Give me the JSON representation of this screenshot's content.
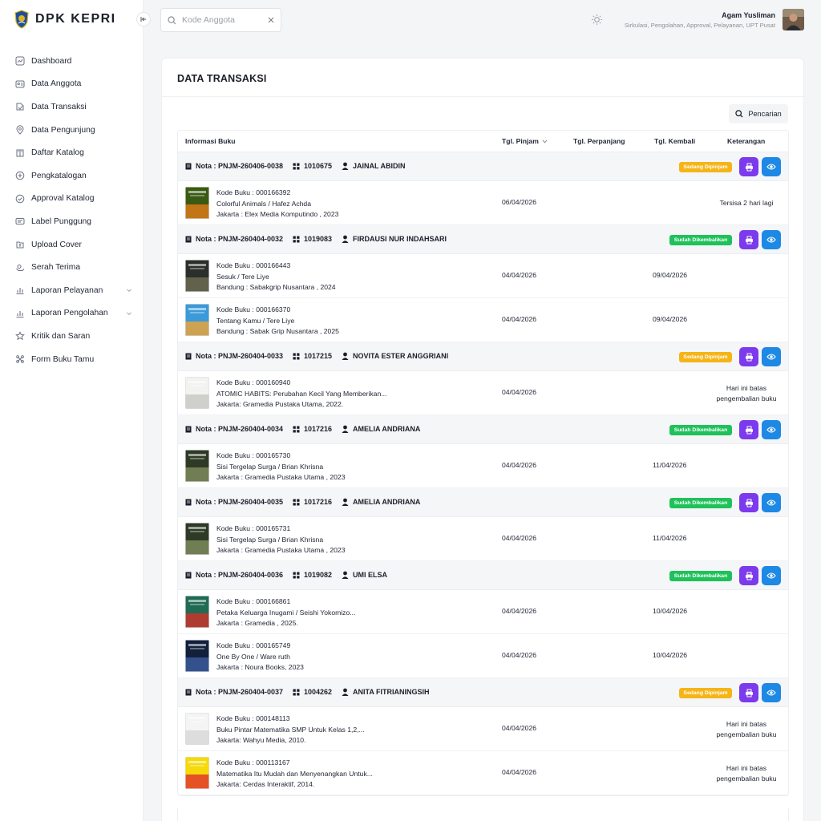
{
  "app": {
    "logo_text": "DPK KEPRI"
  },
  "search": {
    "placeholder": "Kode Anggota"
  },
  "user": {
    "name": "Agam Yusliman",
    "roles": "Sirkulasi, Pengolahan, Approval, Pelayanan, UPT Pusat"
  },
  "sidebar": {
    "items": [
      {
        "label": "Dashboard",
        "icon": "dashboard-icon"
      },
      {
        "label": "Data Anggota",
        "icon": "id-card-icon"
      },
      {
        "label": "Data Transaksi",
        "icon": "transaction-icon"
      },
      {
        "label": "Data Pengunjung",
        "icon": "location-pin-icon"
      },
      {
        "label": "Daftar Katalog",
        "icon": "catalog-icon"
      },
      {
        "label": "Pengkatalogan",
        "icon": "plus-circle-icon"
      },
      {
        "label": "Approval Katalog",
        "icon": "check-circle-icon"
      },
      {
        "label": "Label Punggung",
        "icon": "label-icon"
      },
      {
        "label": "Upload Cover",
        "icon": "upload-icon"
      },
      {
        "label": "Serah Terima",
        "icon": "handover-icon"
      },
      {
        "label": "Laporan Pelayanan",
        "icon": "chart-icon"
      },
      {
        "label": "Laporan Pengolahan",
        "icon": "chart-icon"
      },
      {
        "label": "Kritik dan Saran",
        "icon": "star-icon"
      },
      {
        "label": "Form Buku Tamu",
        "icon": "form-icon"
      }
    ]
  },
  "page": {
    "title": "DATA TRANSAKSI",
    "search_button": "Pencarian"
  },
  "table": {
    "headers": {
      "info": "Informasi Buku",
      "tgl_pinjam": "Tgl. Pinjam",
      "tgl_perpanjang": "Tgl. Perpanjang",
      "tgl_kembali": "Tgl. Kembali",
      "keterangan": "Keterangan"
    },
    "transactions": [
      {
        "nota": "Nota : PNJM-260406-0038",
        "member_id": "1010675",
        "member_name": "JAINAL ABIDIN",
        "status": "Sedang Dipinjam",
        "status_color": "#f5b417",
        "books": [
          {
            "kode": "Kode Buku : 000166392",
            "title": "Colorful Animals / Hafez Achda",
            "publisher": "Jakarta : Elex Media Komputindo , 2023",
            "tgl_pinjam": "06/04/2026",
            "tgl_kembali": "",
            "keterangan": [
              "Tersisa 2 hari lagi"
            ],
            "cover": [
              "#3a5a14",
              "#d97a16"
            ]
          }
        ]
      },
      {
        "nota": "Nota : PNJM-260404-0032",
        "member_id": "1019083",
        "member_name": "FIRDAUSI NUR INDAHSARI",
        "status": "Sudah Dikembalikan",
        "status_color": "#1fc15a",
        "books": [
          {
            "kode": "Kode Buku : 000166443",
            "title": "Sesuk / Tere Liye",
            "publisher": "Bandung : Sabakgrip Nusantara , 2024",
            "tgl_pinjam": "04/04/2026",
            "tgl_kembali": "09/04/2026",
            "keterangan": [],
            "cover": [
              "#2b2e2a",
              "#6b6a52"
            ]
          },
          {
            "kode": "Kode Buku : 000166370",
            "title": "Tentang Kamu / Tere Liye",
            "publisher": "Bandung : Sabak Grip Nusantara , 2025",
            "tgl_pinjam": "04/04/2026",
            "tgl_kembali": "09/04/2026",
            "keterangan": [],
            "cover": [
              "#3b9ad9",
              "#e8a33a"
            ]
          }
        ]
      },
      {
        "nota": "Nota : PNJM-260404-0033",
        "member_id": "1017215",
        "member_name": "NOVITA ESTER ANGGRIANI",
        "status": "Sedang Dipinjam",
        "status_color": "#f5b417",
        "books": [
          {
            "kode": "Kode Buku : 000160940",
            "title": "ATOMIC HABITS: Perubahan Kecil Yang Memberikan...",
            "publisher": "Jakarta: Gramedia Pustaka Utama, 2022.",
            "tgl_pinjam": "04/04/2026",
            "tgl_kembali": "",
            "keterangan": [
              "Hari ini batas",
              "pengembalian buku"
            ],
            "cover": [
              "#f2f2f0",
              "#c9c9c4"
            ]
          }
        ]
      },
      {
        "nota": "Nota : PNJM-260404-0034",
        "member_id": "1017216",
        "member_name": "AMELIA ANDRIANA",
        "status": "Sudah Dikembalikan",
        "status_color": "#1fc15a",
        "books": [
          {
            "kode": "Kode Buku : 000165730",
            "title": "Sisi Tergelap Surga / Brian Khrisna",
            "publisher": "Jakarta : Gramedia Pustaka Utama , 2023",
            "tgl_pinjam": "04/04/2026",
            "tgl_kembali": "11/04/2026",
            "keterangan": [],
            "cover": [
              "#2f3a26",
              "#7c8a5a"
            ]
          }
        ]
      },
      {
        "nota": "Nota : PNJM-260404-0035",
        "member_id": "1017216",
        "member_name": "AMELIA ANDRIANA",
        "status": "Sudah Dikembalikan",
        "status_color": "#1fc15a",
        "books": [
          {
            "kode": "Kode Buku : 000165731",
            "title": "Sisi Tergelap Surga / Brian Khrisna",
            "publisher": "Jakarta : Gramedia Pustaka Utama , 2023",
            "tgl_pinjam": "04/04/2026",
            "tgl_kembali": "11/04/2026",
            "keterangan": [],
            "cover": [
              "#2f3a26",
              "#7c8a5a"
            ]
          }
        ]
      },
      {
        "nota": "Nota : PNJM-260404-0036",
        "member_id": "1019082",
        "member_name": "UMI ELSA",
        "status": "Sudah Dikembalikan",
        "status_color": "#1fc15a",
        "books": [
          {
            "kode": "Kode Buku : 000166861",
            "title": "Petaka Keluarga Inugami / Seishi Yokomizo...",
            "publisher": "Jakarta : Gramedia , 2025.",
            "tgl_pinjam": "04/04/2026",
            "tgl_kembali": "10/04/2026",
            "keterangan": [],
            "cover": [
              "#1f6b54",
              "#c8342c"
            ]
          },
          {
            "kode": "Kode Buku : 000165749",
            "title": "One By One / Ware ruth",
            "publisher": "Jakarta : Noura Books, 2023",
            "tgl_pinjam": "04/04/2026",
            "tgl_kembali": "10/04/2026",
            "keterangan": [],
            "cover": [
              "#13203c",
              "#3a5b9a"
            ]
          }
        ]
      },
      {
        "nota": "Nota : PNJM-260404-0037",
        "member_id": "1004262",
        "member_name": "ANITA FITRIANINGSIH",
        "status": "Sedang Dipinjam",
        "status_color": "#f5b417",
        "books": [
          {
            "kode": "Kode Buku : 000148113",
            "title": "Buku Pintar Matematika SMP Untuk Kelas 1,2,...",
            "publisher": "Jakarta: Wahyu Media, 2010.",
            "tgl_pinjam": "04/04/2026",
            "tgl_kembali": "",
            "keterangan": [
              "Hari ini batas",
              "pengembalian buku"
            ],
            "cover": [
              "#f4f4f4",
              "#d8d8d8"
            ]
          },
          {
            "kode": "Kode Buku : 000113167",
            "title": "Matematika Itu Mudah dan Menyenangkan Untuk...",
            "publisher": "Jakarta: Cerdas Interaktif, 2014.",
            "tgl_pinjam": "04/04/2026",
            "tgl_kembali": "",
            "keterangan": [
              "Hari ini batas",
              "pengembalian buku"
            ],
            "cover": [
              "#f5d90a",
              "#e23a2a"
            ]
          }
        ]
      }
    ]
  },
  "colors": {
    "purple_action": "#7c3aed",
    "blue_action": "#1e88e5",
    "status_borrowed": "#f5b417",
    "status_returned": "#1fc15a"
  }
}
